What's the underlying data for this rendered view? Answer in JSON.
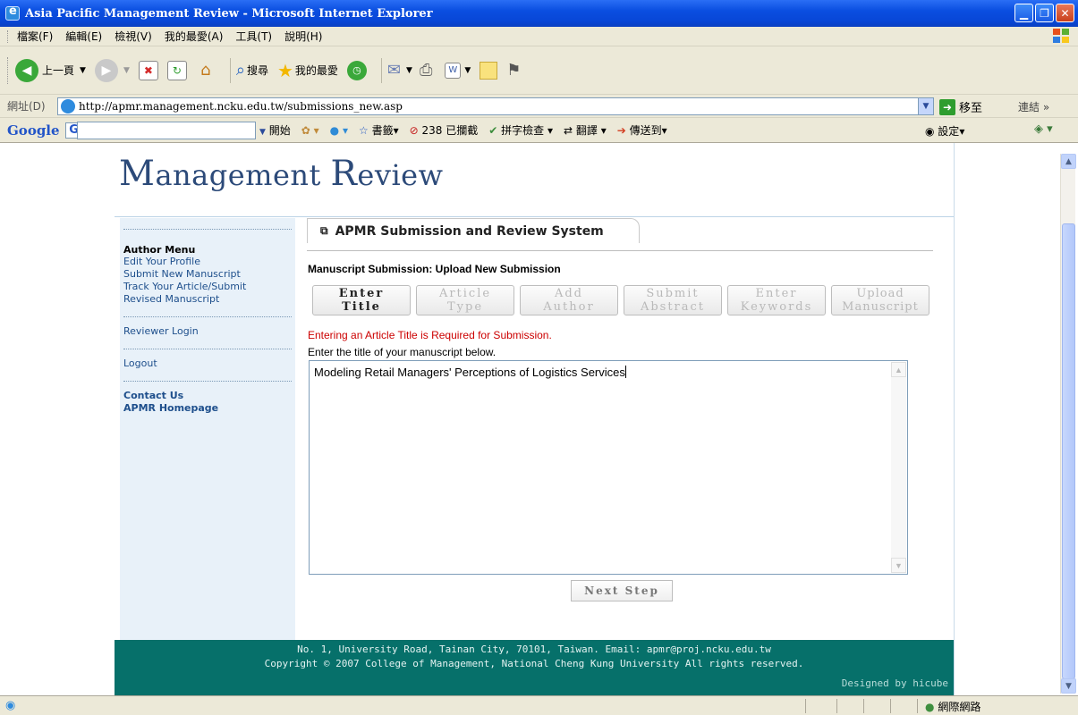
{
  "window": {
    "title": "Asia Pacific Management Review - Microsoft Internet Explorer"
  },
  "menu": [
    "檔案(F)",
    "編輯(E)",
    "檢視(V)",
    "我的最愛(A)",
    "工具(T)",
    "說明(H)"
  ],
  "toolbar": {
    "back_label": "上一頁",
    "search_label": "搜尋",
    "favorites_label": "我的最愛"
  },
  "address": {
    "label": "網址(D)",
    "url": "http://apmr.management.ncku.edu.tw/submissions_new.asp",
    "go_label": "移至",
    "links_label": "連結"
  },
  "googlebar": {
    "logo": "Google",
    "start_label": "開始",
    "bookmarks_label": "書籤",
    "blocked_label": "238 已攔截",
    "spell_label": "拼字檢查",
    "translate_label": "翻譯",
    "send_label": "傳送到",
    "settings_label": "設定"
  },
  "site": {
    "masthead_m": "M",
    "masthead_rest1": "anagement ",
    "masthead_r": "R",
    "masthead_rest2": "eview"
  },
  "sidebar": {
    "menu_title": "Author Menu",
    "links": [
      "Edit Your Profile",
      "Submit New Manuscript",
      "Track Your Article/Submit Revised Manuscript"
    ],
    "reviewer_login": "Reviewer Login",
    "logout": "Logout",
    "contact": "Contact Us",
    "homepage": "APMR Homepage"
  },
  "main": {
    "tab_label": "APMR Submission and Review System",
    "subtitle": "Manuscript Submission: Upload New Submission",
    "steps": [
      {
        "line1": "Enter",
        "line2": "Title"
      },
      {
        "line1": "Article",
        "line2": "Type"
      },
      {
        "line1": "Add",
        "line2": "Author"
      },
      {
        "line1": "Submit",
        "line2": "Abstract"
      },
      {
        "line1": "Enter",
        "line2": "Keywords"
      },
      {
        "line1": "Upload",
        "line2": "Manuscript"
      }
    ],
    "error": "Entering an Article Title is Required for Submission.",
    "instruction": "Enter the title of your manuscript below.",
    "title_value": "Modeling Retail Managers' Perceptions of Logistics Services",
    "next_label": "Next Step"
  },
  "footer": {
    "line1": "No. 1, University Road, Tainan City, 70101, Taiwan.  Email: apmr@proj.ncku.edu.tw",
    "line2": "Copyright © 2007 College of Management, National Cheng Kung University All rights reserved.",
    "designed": "Designed by hicube"
  },
  "status": {
    "zone": "網際網路"
  },
  "colors": {
    "footer_bg": "#06706a",
    "error": "#cc0000",
    "masthead": "#2c4a79",
    "sidebar_bg": "#e8f1f9",
    "link": "#1e4f8c"
  }
}
